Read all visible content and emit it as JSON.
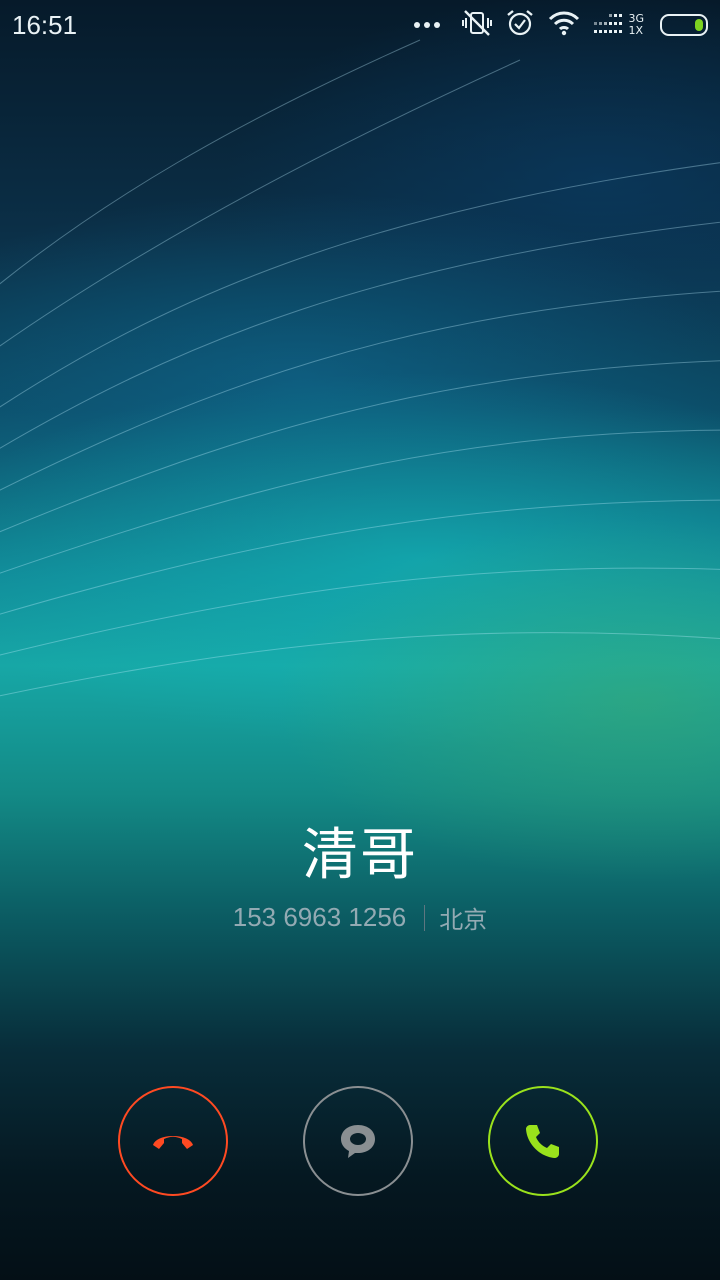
{
  "status_bar": {
    "time": "16:51",
    "network_type_top": "3G",
    "network_type_bottom": "1X",
    "icons": [
      "more-dots-icon",
      "silent-vibrate-icon",
      "alarm-icon",
      "wifi-icon",
      "signal-icon",
      "battery-icon"
    ],
    "battery_level": 0.2,
    "battery_color": "#7ed321"
  },
  "caller": {
    "name": "清哥",
    "number": "153 6963 1256",
    "location": "北京"
  },
  "actions": {
    "decline": {
      "icon": "hang-up-icon",
      "color": "#ff4a22"
    },
    "message": {
      "icon": "chat-bubble-icon",
      "color": "#8a8f92"
    },
    "answer": {
      "icon": "phone-icon",
      "color": "#9ae21c"
    }
  }
}
